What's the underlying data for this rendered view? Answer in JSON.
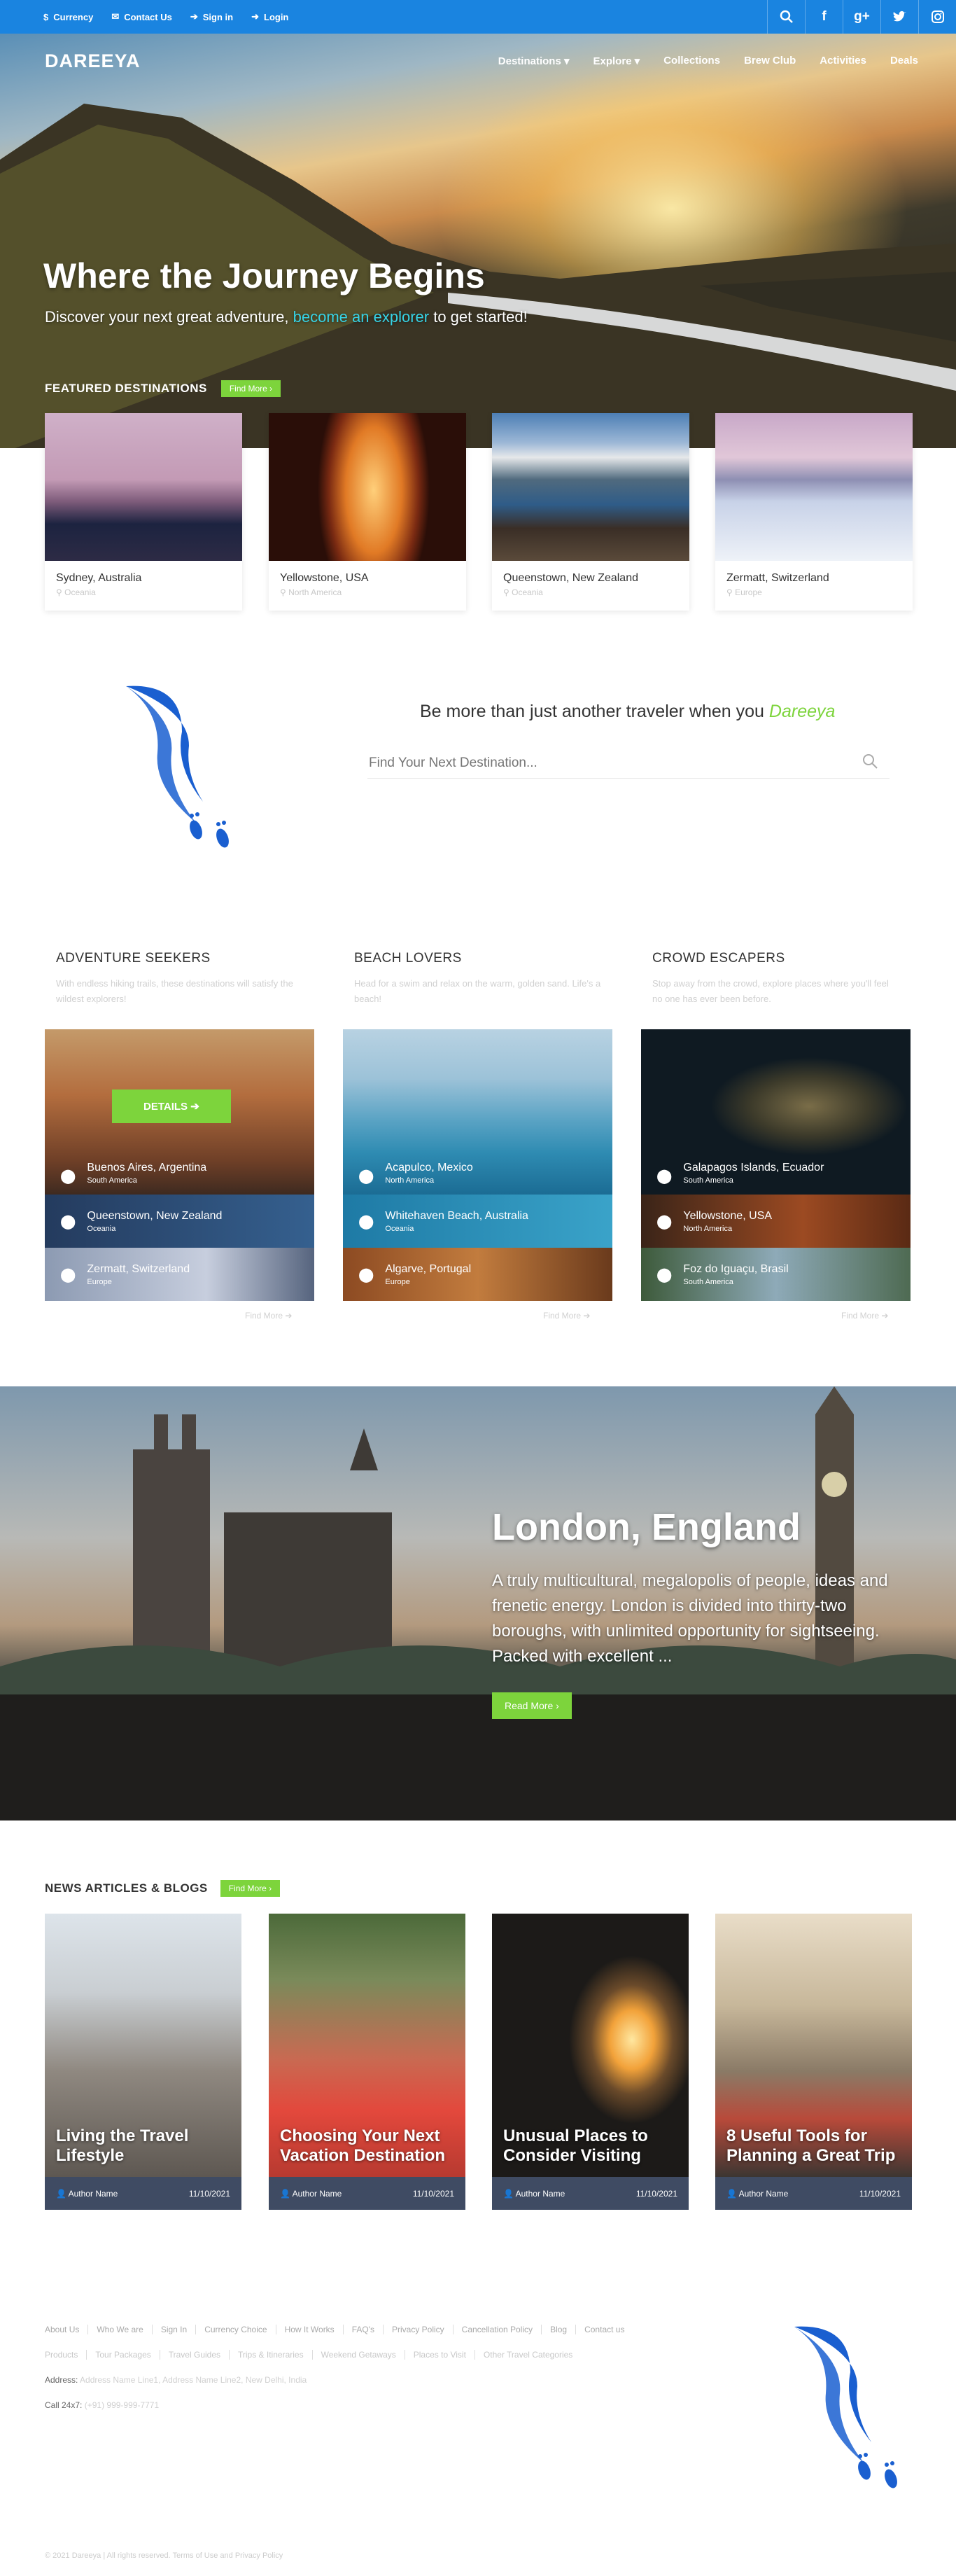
{
  "topbar": {
    "items": [
      "Currency",
      "Contact Us",
      "Sign in",
      "Login"
    ],
    "icons": [
      "search-icon",
      "facebook-icon",
      "google-plus-icon",
      "twitter-icon",
      "instagram-icon"
    ]
  },
  "nav": {
    "logo": "DAREEYA",
    "items": [
      "Destinations ▾",
      "Explore ▾",
      "Collections",
      "Brew Club",
      "Activities",
      "Deals"
    ]
  },
  "hero": {
    "title": "Where the Journey Begins",
    "subtitle_pre": "Discover your next great adventure,",
    "subtitle_link": "become an explorer",
    "subtitle_post": "to get started!"
  },
  "featured": {
    "title": "FEATURED DESTINATIONS",
    "button": "Find More ›",
    "items": [
      {
        "name": "Sydney, Australia",
        "region": "Oceania"
      },
      {
        "name": "Yellowstone, USA",
        "region": "North America"
      },
      {
        "name": "Queenstown, New Zealand",
        "region": "Oceania"
      },
      {
        "name": "Zermatt, Switzerland",
        "region": "Europe"
      }
    ]
  },
  "explore": {
    "tagline_pre": "Be more than just another traveler when you",
    "tagline_brand": "Dareeya",
    "search_placeholder": "Find Your Next Destination..."
  },
  "categories": [
    {
      "title": "ADVENTURE SEEKERS",
      "desc": "With endless hiking trails, these destinations will satisfy the wildest explorers!",
      "details": "DETAILS ➔",
      "more": "Find More ➔",
      "places": [
        {
          "name": "Buenos Aires, Argentina",
          "region": "South America"
        },
        {
          "name": "Queenstown, New Zealand",
          "region": "Oceania"
        },
        {
          "name": "Zermatt, Switzerland",
          "region": "Europe"
        }
      ]
    },
    {
      "title": "BEACH LOVERS",
      "desc": "Head for a swim and relax on the warm, golden sand. Life's a beach!",
      "more": "Find More ➔",
      "places": [
        {
          "name": "Acapulco, Mexico",
          "region": "North America"
        },
        {
          "name": "Whitehaven Beach, Australia",
          "region": "Oceania"
        },
        {
          "name": "Algarve, Portugal",
          "region": "Europe"
        }
      ]
    },
    {
      "title": "CROWD ESCAPERS",
      "desc": "Stop away from the crowd, explore places where you'll feel no one has ever been before.",
      "more": "Find More ➔",
      "places": [
        {
          "name": "Galapagos Islands, Ecuador",
          "region": "South America"
        },
        {
          "name": "Yellowstone, USA",
          "region": "North America"
        },
        {
          "name": "Foz do Iguaçu, Brasil",
          "region": "South America"
        }
      ]
    }
  ],
  "spotlight": {
    "title": "London, England",
    "text": "A truly multicultural, megalopolis of people, ideas and frenetic energy. London is divided into thirty-two boroughs, with unlimited opportunity for sightseeing. Packed with excellent ...",
    "button": "Read More ›"
  },
  "news": {
    "title": "NEWS ARTICLES & BLOGS",
    "button": "Find More ›",
    "items": [
      {
        "title": "Living the Travel Lifestyle",
        "author": "Author Name",
        "date": "11/10/2021"
      },
      {
        "title": "Choosing Your Next Vacation Destination",
        "author": "Author Name",
        "date": "11/10/2021"
      },
      {
        "title": "Unusual Places to Consider Visiting",
        "author": "Author Name",
        "date": "11/10/2021"
      },
      {
        "title": "8 Useful Tools for Planning a Great Trip",
        "author": "Author Name",
        "date": "11/10/2021"
      }
    ]
  },
  "footer": {
    "links1": [
      "About Us",
      "Who We are",
      "Sign In",
      "Currency Choice",
      "How It Works",
      "FAQ's",
      "Privacy Policy",
      "Cancellation Policy",
      "Blog",
      "Contact us"
    ],
    "links2": [
      "Products",
      "Tour Packages",
      "Travel Guides",
      "Trips & Itineraries",
      "Weekend Getaways",
      "Places to Visit",
      "Other Travel Categories"
    ],
    "address_label": "Address:",
    "address": "Address Name Line1, Address Name Line2, New Delhi, India",
    "call_label": "Call 24x7:",
    "call": "(+91) 999-999-7771",
    "copyright": "© 2021 Dareeya | All rights reserved. Terms of Use and Privacy Policy"
  },
  "colors": {
    "topbar": "#1a84e0",
    "accent_green": "#7dd43c",
    "news_meta": "#3f4b63",
    "brand_blue": "#1a5fd0"
  }
}
